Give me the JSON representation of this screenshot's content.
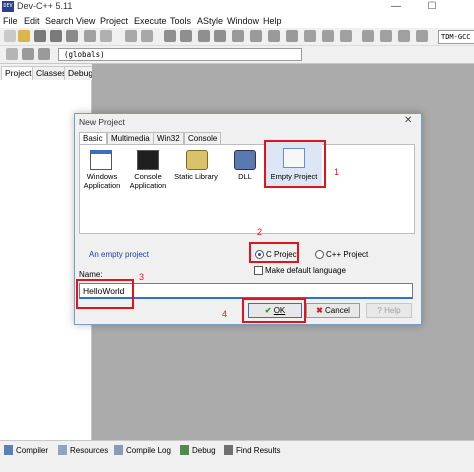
{
  "window": {
    "title": "Dev-C++ 5.11",
    "app_icon_text": "DEV",
    "minimize": "—",
    "maximize": "☐"
  },
  "menu": [
    "File",
    "Edit",
    "Search",
    "View",
    "Project",
    "Execute",
    "Tools",
    "AStyle",
    "Window",
    "Help"
  ],
  "toolbar": {
    "globals": "(globals)",
    "compiler": "TDM-GCC"
  },
  "left_tabs": [
    "Project",
    "Classes",
    "Debug"
  ],
  "bottom_tabs": [
    "Compiler",
    "Resources",
    "Compile Log",
    "Debug",
    "Find Results"
  ],
  "dialog": {
    "title": "New Project",
    "close": "✕",
    "tabs": [
      "Basic",
      "Multimedia",
      "Win32",
      "Console"
    ],
    "templates": [
      {
        "label_line1": "Windows",
        "label_line2": "Application",
        "icon": "windows-app-icon"
      },
      {
        "label_line1": "Console",
        "label_line2": "Application",
        "icon": "console-app-icon"
      },
      {
        "label_line1": "Static Library",
        "label_line2": "",
        "icon": "static-library-icon"
      },
      {
        "label_line1": "DLL",
        "label_line2": "",
        "icon": "dll-icon"
      },
      {
        "label_line1": "Empty Project",
        "label_line2": "",
        "icon": "empty-project-icon"
      }
    ],
    "description": "An empty project",
    "c_project": "C Project",
    "cpp_project": "C++ Project",
    "make_default": "Make default language",
    "name_label": "Name:",
    "name_value": "HelloWorld",
    "ok": "OK",
    "cancel": "Cancel",
    "help": "Help"
  },
  "annotations": [
    "1",
    "2",
    "3",
    "4"
  ],
  "colors": {
    "annotation_red": "#e0141b",
    "editor_bg": "#ababab",
    "link_blue": "#1f3f9f"
  }
}
